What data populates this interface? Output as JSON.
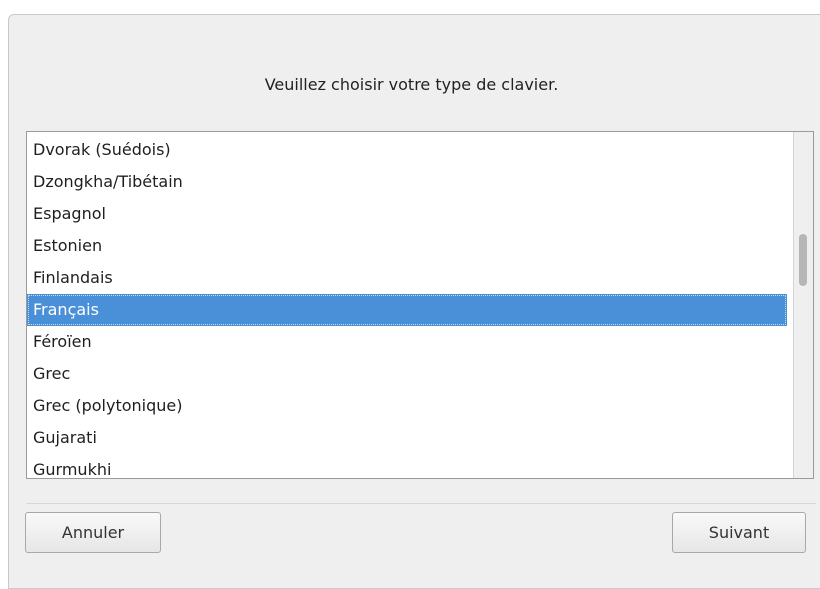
{
  "dialog": {
    "prompt": "Veuillez choisir votre type de clavier."
  },
  "keyboard_list": {
    "items": [
      {
        "label": "Dvorak (Suédois)",
        "selected": false
      },
      {
        "label": "Dzongkha/Tibétain",
        "selected": false
      },
      {
        "label": "Espagnol",
        "selected": false
      },
      {
        "label": "Estonien",
        "selected": false
      },
      {
        "label": "Finlandais",
        "selected": false
      },
      {
        "label": "Français",
        "selected": true
      },
      {
        "label": "Féroïen",
        "selected": false
      },
      {
        "label": "Grec",
        "selected": false
      },
      {
        "label": "Grec (polytonique)",
        "selected": false
      },
      {
        "label": "Gujarati",
        "selected": false
      },
      {
        "label": "Gurmukhi",
        "selected": false
      }
    ],
    "selected_value": "Français"
  },
  "buttons": {
    "cancel_label": "Annuler",
    "next_label": "Suivant"
  },
  "colors": {
    "selection": "#4a90d9",
    "dialog_background": "#efefef"
  }
}
